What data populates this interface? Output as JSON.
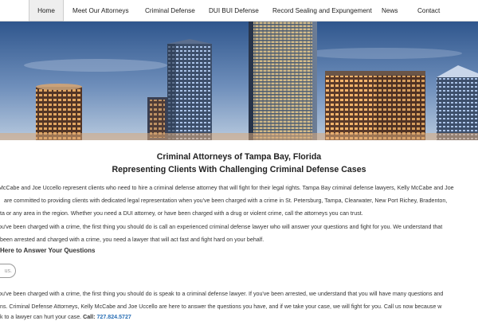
{
  "nav": {
    "items": [
      {
        "label": "Home"
      },
      {
        "label": "Meet Our Attorneys"
      },
      {
        "label": "Criminal Defense"
      },
      {
        "label": "DUI BUI Defense"
      },
      {
        "label": "Record Sealing and Expungement"
      },
      {
        "label": "News"
      },
      {
        "label": "Contact"
      }
    ]
  },
  "hero": {
    "image": "tampa-skyline-dusk",
    "colors": {
      "sky_top": "#3b5f95",
      "sky_bottom": "#a9bfd8"
    }
  },
  "main": {
    "heading1": "Criminal Attorneys of Tampa Bay, Florida",
    "heading2": "Representing Clients With Challenging Criminal Defense Cases",
    "intro": [
      "McCabe and Joe Uccello represent clients who need to hire a criminal defense attorney that will fight for their legal rights. Tampa Bay criminal defense lawyers, Kelly McCabe and Joe",
      "are committed to providing clients with dedicated legal representation when you've been charged with a crime in St. Petersburg, Tampa, Clearwater, New Port Richey, Bradenton,",
      "ta or any area in the region. Whether you need a DUI attorney, or have been charged with a drug or violent crime, call the attorneys you can trust."
    ],
    "para2": [
      "ou've been charged with a crime, the first thing you should do is call an experienced criminal defense lawyer who will answer your questions and fight for you.  We understand that",
      "been arrested and charged with a crime, you need a lawyer that will act fast and fight hard on your behalf."
    ],
    "subheading": "Here to Answer Your Questions",
    "pill_text": "us.",
    "para3": [
      "ou've been charged with a  crime, the first thing you should do is speak to a criminal defense lawyer.  If you've been arrested, we understand that you will have many questions and",
      "ns.  Criminal Defense Attorneys, Kelly McCabe and Joe Uccello are here to answer the questions you have, and if we take your case, we will fight for you.  Call us now because w",
      "k to a lawyer can hurt your case."
    ],
    "call_label": "Call:",
    "phone": "727.824.5727",
    "accent_color": "#2a6fb5"
  }
}
